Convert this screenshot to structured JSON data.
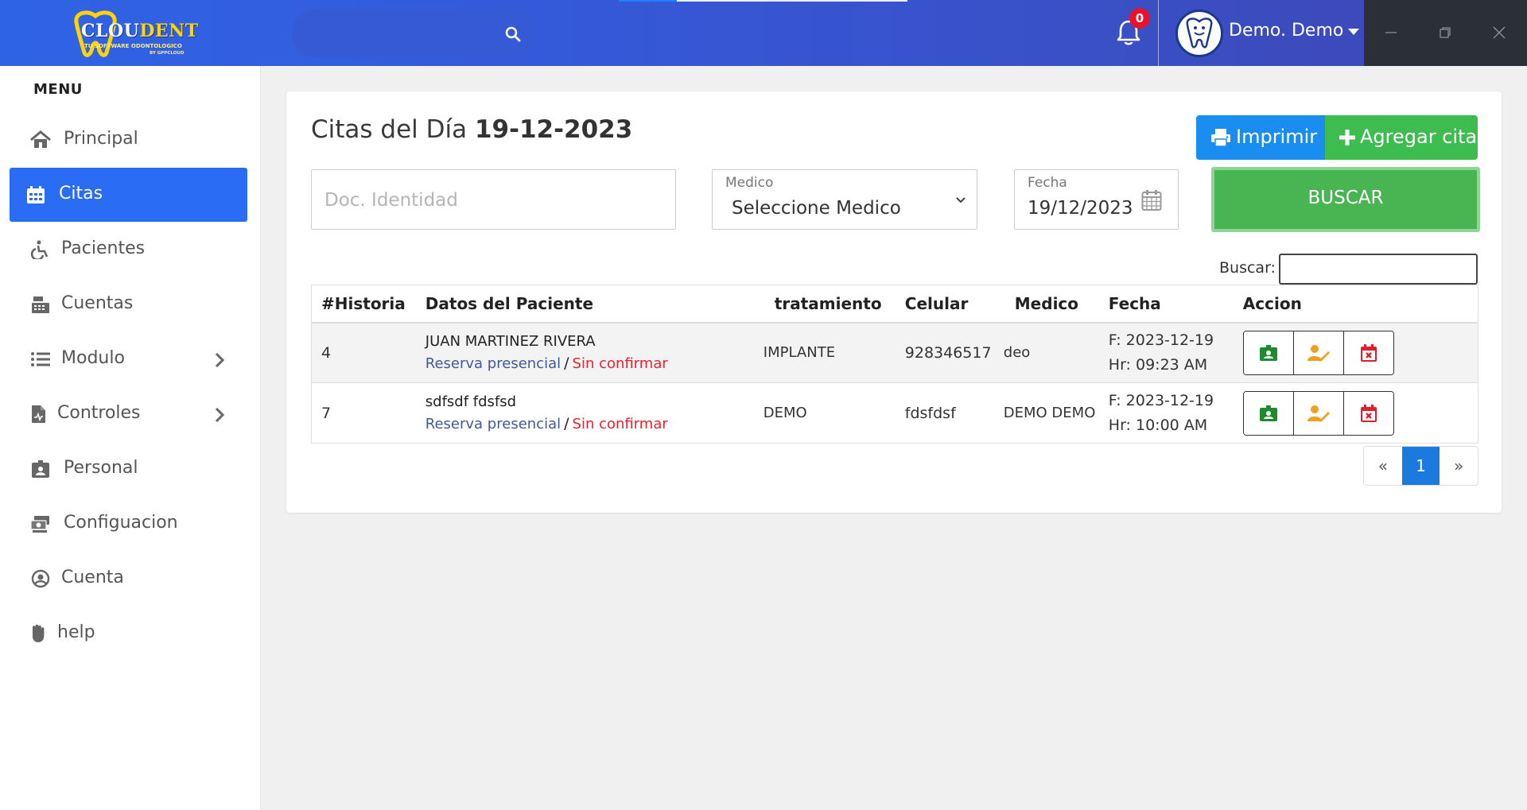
{
  "topbar": {
    "logo_text_a": "CLOU",
    "logo_text_b": "DENT",
    "logo_sub": "TU SOFTWARE ODONTOLOGICO",
    "logo_by": "BY GPPCLOUD",
    "search_placeholder": "",
    "notification_count": "0",
    "user_name": "Demo. Demo"
  },
  "sidebar": {
    "menu_title": "MENU",
    "items": [
      {
        "label": "Principal",
        "icon": "home-icon"
      },
      {
        "label": "Citas",
        "icon": "calendar-icon"
      },
      {
        "label": "Pacientes",
        "icon": "wheelchair-icon"
      },
      {
        "label": "Cuentas",
        "icon": "cash-register-icon"
      },
      {
        "label": "Modulo",
        "icon": "list-icon"
      },
      {
        "label": "Controles",
        "icon": "file-medical-icon"
      },
      {
        "label": "Personal",
        "icon": "id-badge-icon"
      },
      {
        "label": "Configuacion",
        "icon": "cash-settings-icon"
      },
      {
        "label": "Cuenta",
        "icon": "user-circle-icon"
      },
      {
        "label": "help",
        "icon": "hand-icon"
      }
    ]
  },
  "main": {
    "title_prefix": "Citas del Día",
    "title_date": "19-12-2023",
    "print_label": "Imprimir",
    "add_label": "Agregar cita",
    "doc_placeholder": "Doc. Identidad",
    "medico_label": "Medico",
    "medico_value": "Seleccione Medico",
    "fecha_label": "Fecha",
    "fecha_value": "19/12/2023",
    "buscar_label": "BUSCAR",
    "filter_label": "Buscar:",
    "columns": [
      "#Historia",
      "Datos del Paciente",
      "tratamiento",
      "Celular",
      "Medico",
      "Fecha",
      "Accion"
    ],
    "rows": [
      {
        "historia": "4",
        "nombre": "JUAN MARTINEZ RIVERA",
        "reserva": "Reserva presencial",
        "sep": "/",
        "estado": "Sin confirmar",
        "tratamiento": "IMPLANTE",
        "celular": "928346517",
        "medico": "deo",
        "fecha": "F: 2023-12-19",
        "hora": "Hr: 09:23 AM"
      },
      {
        "historia": "7",
        "nombre": "sdfsdf fdsfsd",
        "reserva": "Reserva presencial",
        "sep": "/",
        "estado": "Sin confirmar",
        "tratamiento": "DEMO",
        "celular": "fdsfdsf",
        "medico": "DEMO DEMO",
        "fecha": "F: 2023-12-19",
        "hora": "Hr: 10:00 AM"
      }
    ],
    "pager": {
      "prev": "«",
      "current": "1",
      "next": "»"
    }
  },
  "colors": {
    "topbar": "#2f63e6",
    "active_nav": "#2a6df4",
    "print": "#1a8ef0",
    "add": "#3dbd4f",
    "buscar": "#49b552",
    "confirm_red": "#e8232e"
  }
}
